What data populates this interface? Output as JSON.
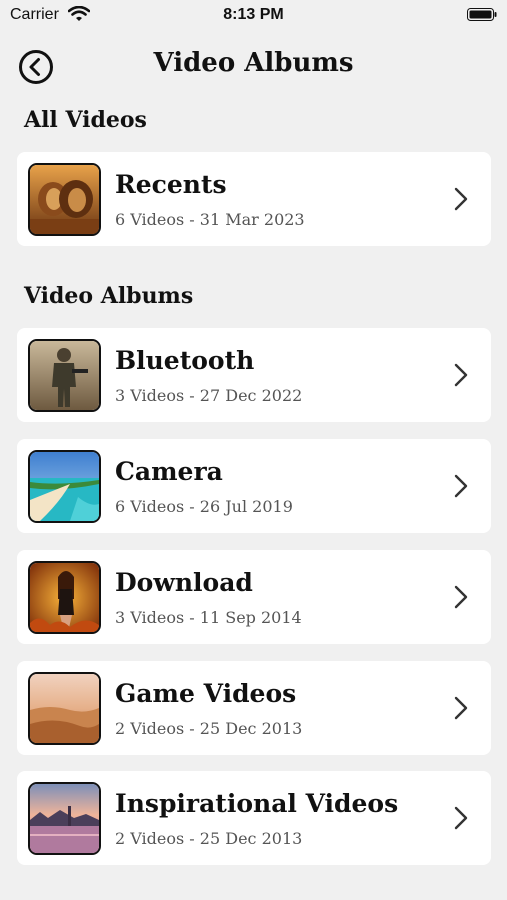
{
  "status": {
    "carrier": "Carrier",
    "time": "8:13 PM"
  },
  "nav": {
    "title": "Video Albums",
    "back_icon": "back-arrow-circle-icon"
  },
  "sections": {
    "all_videos": "All Videos",
    "video_albums": "Video Albums"
  },
  "recents": {
    "title": "Recents",
    "subtitle": "6 Videos - 31 Mar 2023",
    "thumb": "lions"
  },
  "albums": [
    {
      "title": "Bluetooth",
      "subtitle": "3 Videos - 27 Dec 2022",
      "thumb": "soldier"
    },
    {
      "title": "Camera",
      "subtitle": "6 Videos - 26 Jul 2019",
      "thumb": "beach"
    },
    {
      "title": "Download",
      "subtitle": "3 Videos - 11 Sep 2014",
      "thumb": "fire-woman"
    },
    {
      "title": "Game Videos",
      "subtitle": "2 Videos - 25 Dec 2013",
      "thumb": "desert"
    },
    {
      "title": "Inspirational Videos",
      "subtitle": "2 Videos - 25 Dec 2013",
      "thumb": "sunset-lake"
    }
  ],
  "colors": {
    "background": "#f0f0f0",
    "card": "#ffffff",
    "subtitle": "#555555"
  }
}
